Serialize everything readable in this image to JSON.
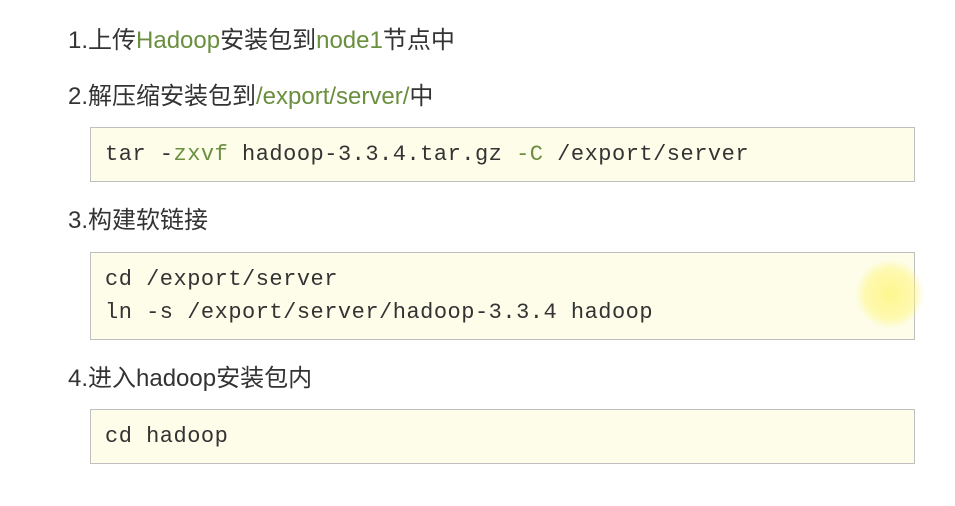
{
  "steps": [
    {
      "num": "1. ",
      "parts": [
        {
          "text": "上传",
          "class": ""
        },
        {
          "text": "Hadoop",
          "class": "hl-green"
        },
        {
          "text": "安装包到",
          "class": ""
        },
        {
          "text": "node1",
          "class": "hl-green"
        },
        {
          "text": "节点中",
          "class": ""
        }
      ],
      "code": null
    },
    {
      "num": "2. ",
      "parts": [
        {
          "text": "解压缩安装包到",
          "class": ""
        },
        {
          "text": "/export/server/",
          "class": "hl-green"
        },
        {
          "text": "中",
          "class": ""
        }
      ],
      "code": [
        [
          {
            "text": "tar -",
            "class": ""
          },
          {
            "text": "zxvf",
            "class": "code-blue"
          },
          {
            "text": " hadoop-3.3.4.tar.gz ",
            "class": ""
          },
          {
            "text": "-C",
            "class": "code-blue"
          },
          {
            "text": " /export/server",
            "class": ""
          }
        ]
      ]
    },
    {
      "num": "3. ",
      "parts": [
        {
          "text": "构建软链接",
          "class": ""
        }
      ],
      "code": [
        [
          {
            "text": "cd /export/server",
            "class": ""
          }
        ],
        [
          {
            "text": "ln -s /export/server/hadoop-3.3.4 hadoop",
            "class": ""
          }
        ]
      ]
    },
    {
      "num": "4. ",
      "parts": [
        {
          "text": "进入hadoop安装包内",
          "class": ""
        }
      ],
      "code": [
        [
          {
            "text": "cd hadoop",
            "class": ""
          }
        ]
      ]
    }
  ]
}
